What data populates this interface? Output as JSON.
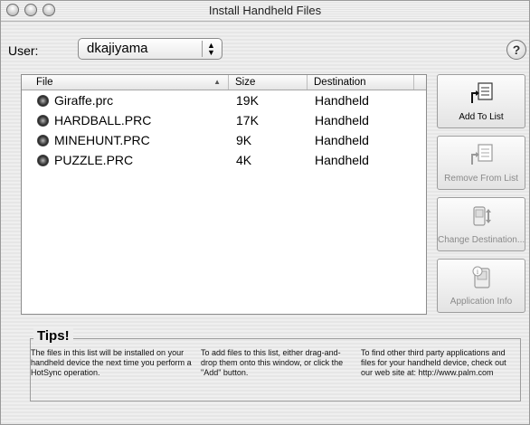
{
  "window": {
    "title": "Install Handheld Files"
  },
  "user": {
    "label": "User:",
    "selected": "dkajiyama"
  },
  "help": {
    "glyph": "?"
  },
  "table": {
    "columns": {
      "file": "File",
      "size": "Size",
      "destination": "Destination"
    },
    "rows": [
      {
        "file": "Giraffe.prc",
        "size": "19K",
        "destination": "Handheld"
      },
      {
        "file": "HARDBALL.PRC",
        "size": "17K",
        "destination": "Handheld"
      },
      {
        "file": "MINEHUNT.PRC",
        "size": "9K",
        "destination": "Handheld"
      },
      {
        "file": "PUZZLE.PRC",
        "size": "4K",
        "destination": "Handheld"
      }
    ]
  },
  "buttons": {
    "add": "Add To List",
    "remove": "Remove From List",
    "change": "Change Destination...",
    "info": "Application Info"
  },
  "tips": {
    "title": "Tips!",
    "col1": "The files in this list will be installed on your handheld device the next time you perform a HotSync operation.",
    "col2": "To add files to this list, either drag-and-drop them onto this window, or click the \"Add\" button.",
    "col3": "To find other third party applications and files for your handheld device, check out our web site at: http://www.palm.com"
  }
}
